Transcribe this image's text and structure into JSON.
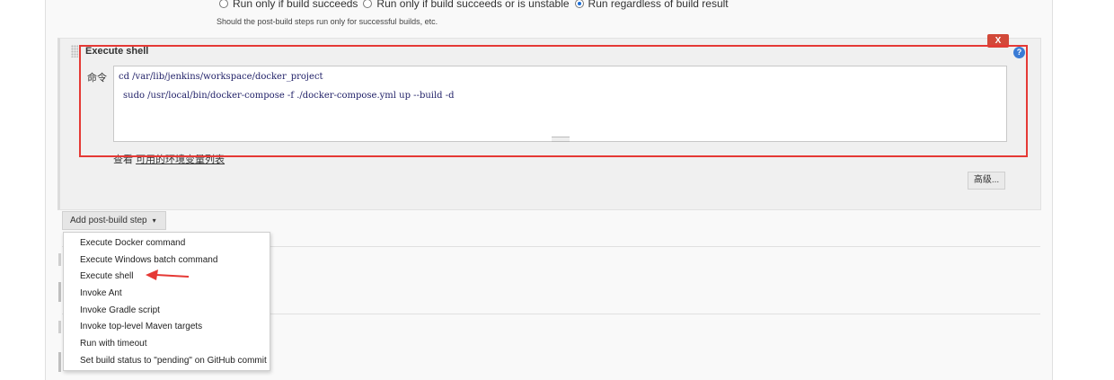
{
  "post_build_options": {
    "radios": [
      {
        "label": "Run only if build succeeds",
        "selected": false
      },
      {
        "label": "Run only if build succeeds or is unstable",
        "selected": false
      },
      {
        "label": "Run regardless of build result",
        "selected": true
      }
    ],
    "hint": "Should the post-build steps run only for successful builds, etc."
  },
  "step": {
    "title": "Execute shell",
    "delete_label": "X",
    "help_label": "?",
    "command_label": "命令",
    "command_line_1": "cd /var/lib/jenkins/workspace/docker_project",
    "command_line_2": "sudo /usr/local/bin/docker-compose -f ./docker-compose.yml up --build -d",
    "env_prefix": "查看 ",
    "env_link": "可用的环境变量列表",
    "advanced_label": "高级..."
  },
  "add_step": {
    "label": "Add post-build step",
    "caret": "▾"
  },
  "menu": {
    "items": [
      "Execute Docker command",
      "Execute Windows batch command",
      "Execute shell",
      "Invoke Ant",
      "Invoke Gradle script",
      "Invoke top-level Maven targets",
      "Run with timeout",
      "Set build status to \"pending\" on GitHub commit"
    ]
  },
  "colors": {
    "highlight": "#e53935",
    "delete_button": "#d24939",
    "help_icon": "#3a7bd5"
  }
}
